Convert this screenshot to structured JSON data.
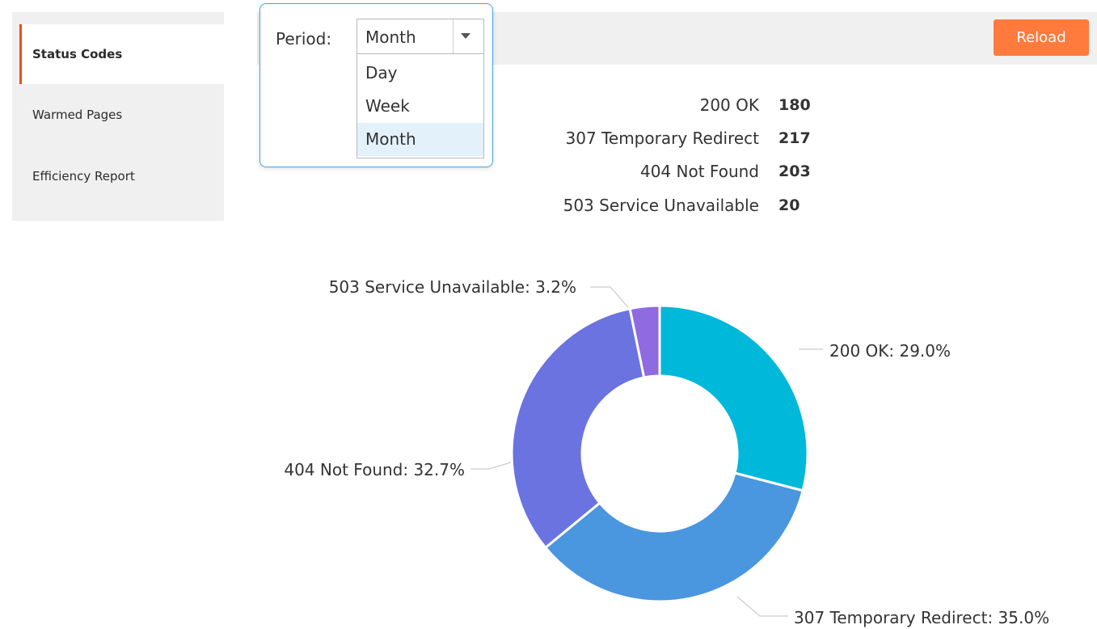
{
  "sidebar": {
    "items": [
      {
        "label": "Status Codes",
        "active": true
      },
      {
        "label": "Warmed Pages",
        "active": false
      },
      {
        "label": "Efficiency Report",
        "active": false
      }
    ],
    "accent_color": "#eb5202"
  },
  "toolbar": {
    "period_label": "Period:",
    "period_selected": "Month",
    "period_options": [
      "Day",
      "Week",
      "Month"
    ],
    "reload_label": "Reload",
    "reload_color": "#ff7a3d"
  },
  "stats": [
    {
      "label": "200 OK",
      "value": "180"
    },
    {
      "label": "307 Temporary Redirect",
      "value": "217"
    },
    {
      "label": "404 Not Found",
      "value": "203"
    },
    {
      "label": "503 Service Unavailable",
      "value": "20"
    }
  ],
  "chart_data": {
    "type": "pie",
    "donut": true,
    "title": "",
    "categories": [
      "200 OK",
      "307 Temporary Redirect",
      "404 Not Found",
      "503 Service Unavailable"
    ],
    "values": [
      180,
      217,
      203,
      20
    ],
    "percentages": [
      29.0,
      35.0,
      32.7,
      3.2
    ],
    "slice_labels": [
      "200 OK: 29.0%",
      "307 Temporary Redirect: 35.0%",
      "404 Not Found: 32.7%",
      "503 Service Unavailable: 3.2%"
    ],
    "colors": [
      "#00b8d9",
      "#4a96df",
      "#6a73e0",
      "#8f6ae0"
    ]
  }
}
